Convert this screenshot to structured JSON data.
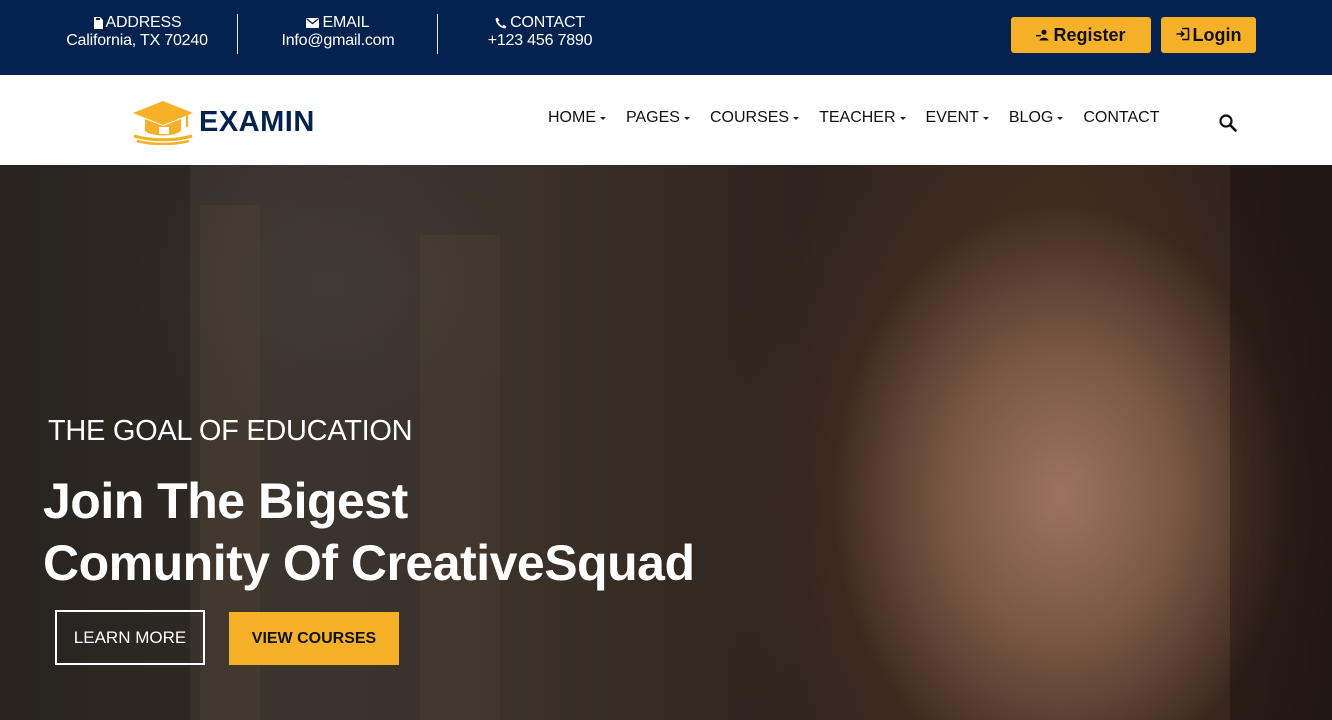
{
  "topbar": {
    "address": {
      "icon": "document-icon",
      "label": "ADDRESS",
      "value": "California, TX 70240"
    },
    "email": {
      "icon": "envelope-icon",
      "label": "EMAIL",
      "value": "Info@gmail.com"
    },
    "contact": {
      "icon": "phone-icon",
      "label": "CONTACT",
      "value": "+123 456 7890"
    },
    "register_label": "Register",
    "login_label": "Login"
  },
  "navbar": {
    "logo_text": "EXAMIN",
    "menu": [
      {
        "label": "HOME",
        "dropdown": true
      },
      {
        "label": "PAGES",
        "dropdown": true
      },
      {
        "label": "COURSES",
        "dropdown": true
      },
      {
        "label": "TEACHER",
        "dropdown": true
      },
      {
        "label": "EVENT",
        "dropdown": true
      },
      {
        "label": "BLOG",
        "dropdown": true
      },
      {
        "label": "CONTACT",
        "dropdown": false
      }
    ],
    "search_icon": "search-icon"
  },
  "hero": {
    "subtitle": "THE GOAL OF EDUCATION",
    "title_line1": "Join The Bigest",
    "title_line2": "Comunity Of CreativeSquad",
    "learn_more_label": "LEARN MORE",
    "view_courses_label": "VIEW COURSES"
  },
  "colors": {
    "primary_navy": "#032250",
    "accent_yellow": "#f6b128",
    "white": "#ffffff"
  }
}
